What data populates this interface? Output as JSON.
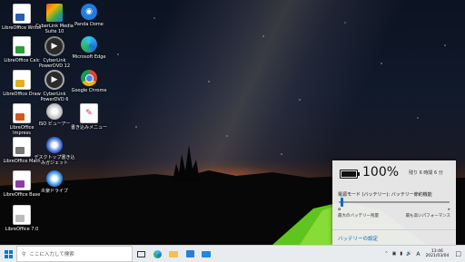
{
  "desktop": {
    "icons": [
      {
        "label": "LibreOffice Writer",
        "icon": "libreoffice-writer-icon"
      },
      {
        "label": "LibreOffice Calc",
        "icon": "libreoffice-calc-icon"
      },
      {
        "label": "LibreOffice Draw",
        "icon": "libreoffice-draw-icon"
      },
      {
        "label": "LibreOffice Impress",
        "icon": "libreoffice-impress-icon"
      },
      {
        "label": "LibreOffice Math",
        "icon": "libreoffice-math-icon"
      },
      {
        "label": "LibreOffice Base",
        "icon": "libreoffice-base-icon"
      },
      {
        "label": "LibreOffice 7.0",
        "icon": "libreoffice-icon"
      },
      {
        "label": "CyberLink Media Suite 10",
        "icon": "cyberlink-media-suite-icon"
      },
      {
        "label": "CyberLink PowerDVD 12",
        "icon": "cyberlink-powerdvd-icon"
      },
      {
        "label": "CyberLink PowerDVD 6",
        "icon": "cyberlink-powerdvd-icon"
      },
      {
        "label": "ISO ビューアー",
        "icon": "iso-viewer-icon"
      },
      {
        "label": "デスクトップ書き込みガジェット",
        "icon": "desktop-burn-gadget-icon"
      },
      {
        "label": "炎楽ドライブ",
        "icon": "disc-drive-icon"
      },
      {
        "label": "Panda Dome",
        "icon": "panda-dome-icon"
      },
      {
        "label": "Microsoft Edge",
        "icon": "microsoft-edge-icon"
      },
      {
        "label": "Google Chrome",
        "icon": "google-chrome-icon"
      },
      {
        "label": "書き込みメニュー",
        "icon": "burn-menu-icon"
      }
    ]
  },
  "battery_flyout": {
    "percent": "100%",
    "remaining": "残り 6 時間 6 分",
    "mode_label": "電源モード (バッテリー): バッテリー節約機能",
    "slider_level": 0.02,
    "left_label": "最大のバッテリー残量",
    "right_label": "最も高いパフォーマンス",
    "settings_link": "バッテリーの設定"
  },
  "taskbar": {
    "search_placeholder": "ここに入力して検索",
    "time": "13:46",
    "date": "2021/03/04",
    "ime": "A"
  },
  "colors": {
    "accent": "#0078d4",
    "link": "#0067b8"
  }
}
